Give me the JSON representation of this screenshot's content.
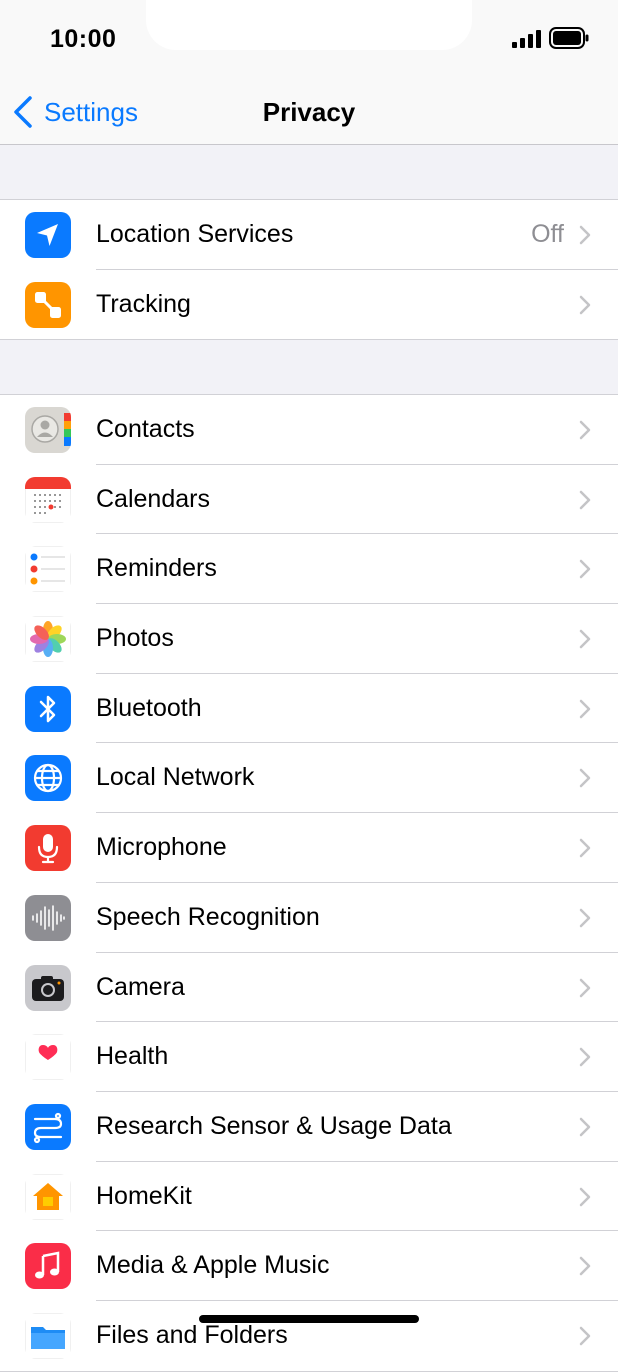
{
  "status": {
    "time": "10:00"
  },
  "nav": {
    "back_label": "Settings",
    "title": "Privacy"
  },
  "group1": [
    {
      "label": "Location Services",
      "value": "Off",
      "icon": "location-arrow-icon"
    },
    {
      "label": "Tracking",
      "value": "",
      "icon": "tracking-icon"
    }
  ],
  "group2": [
    {
      "label": "Contacts",
      "icon": "contacts-icon"
    },
    {
      "label": "Calendars",
      "icon": "calendar-icon"
    },
    {
      "label": "Reminders",
      "icon": "reminders-icon"
    },
    {
      "label": "Photos",
      "icon": "photos-icon"
    },
    {
      "label": "Bluetooth",
      "icon": "bluetooth-icon"
    },
    {
      "label": "Local Network",
      "icon": "globe-icon"
    },
    {
      "label": "Microphone",
      "icon": "microphone-icon"
    },
    {
      "label": "Speech Recognition",
      "icon": "waveform-icon"
    },
    {
      "label": "Camera",
      "icon": "camera-icon"
    },
    {
      "label": "Health",
      "icon": "heart-icon"
    },
    {
      "label": "Research Sensor & Usage Data",
      "icon": "research-icon"
    },
    {
      "label": "HomeKit",
      "icon": "home-icon"
    },
    {
      "label": "Media & Apple Music",
      "icon": "music-note-icon"
    },
    {
      "label": "Files and Folders",
      "icon": "folder-icon"
    }
  ],
  "colors": {
    "accent": "#0a7aff",
    "background": "#f2f2f7",
    "chevron": "#c4c4c7"
  }
}
